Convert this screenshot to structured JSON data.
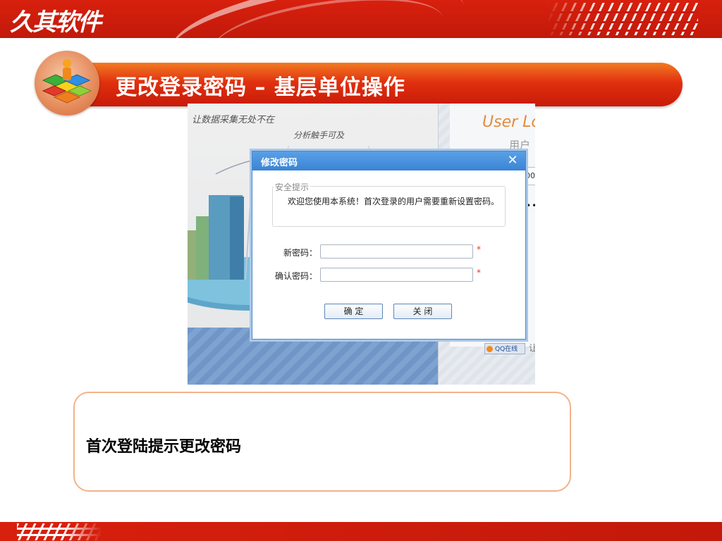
{
  "brand": {
    "name": "久其软件"
  },
  "header": {
    "title": "更改登录密码 – 基层单位操作"
  },
  "screenshot": {
    "slogan_line1": "让数据采集无处不在",
    "slogan_line2": "分析触手可及",
    "login_heading": "User Lo",
    "login_user_label": "用户",
    "qq_label": "QQ在线",
    "qq_side_text": "让",
    "field_fragment": "00",
    "password_dots": "••"
  },
  "dialog": {
    "title": "修改密码",
    "close_glyph": "✕",
    "tip_legend": "安全提示",
    "tip_text": "欢迎您使用本系统！首次登录的用户需要重新设置密码。",
    "new_password_label": "新密码：",
    "confirm_password_label": "确认密码：",
    "new_password_value": "",
    "confirm_password_value": "",
    "required_mark": "*",
    "ok_label": "确 定",
    "close_label": "关 闭"
  },
  "note": {
    "text": "首次登陆提示更改密码"
  },
  "colors": {
    "brand_red": "#c81a0b",
    "title_orange": "#e0300f",
    "dialog_blue": "#3a84d4",
    "note_border": "#f2b389"
  }
}
